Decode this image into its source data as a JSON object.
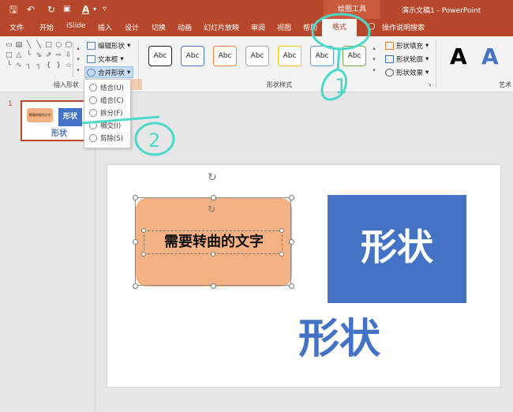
{
  "window": {
    "title": "演示文稿1 - PowerPoint",
    "context_group": "绘图工具"
  },
  "quick_access": {
    "save_icon": "save-icon",
    "undo_icon": "undo-icon",
    "redo_icon": "redo-icon",
    "font_color_label": "A",
    "customize_icon": "customize-icon"
  },
  "tabs": [
    {
      "label": "文件"
    },
    {
      "label": "开始"
    },
    {
      "label": "iSlide"
    },
    {
      "label": "插入"
    },
    {
      "label": "设计"
    },
    {
      "label": "切换"
    },
    {
      "label": "动画"
    },
    {
      "label": "幻灯片放映"
    },
    {
      "label": "审阅"
    },
    {
      "label": "视图"
    },
    {
      "label": "帮助"
    },
    {
      "label": "格式"
    },
    {
      "label": "操作说明搜索"
    }
  ],
  "ribbon": {
    "insert_shapes": {
      "group_label": "插入形状",
      "edit_shape": "编辑形状",
      "text_box": "文本框",
      "merge_shapes": "合并形状"
    },
    "shape_styles": {
      "group_label": "形状样式",
      "style_sample": "Abc",
      "styles": [
        {
          "label": "Abc",
          "border": "#222222"
        },
        {
          "label": "Abc",
          "border": "#4472c4"
        },
        {
          "label": "Abc",
          "border": "#ed7d31"
        },
        {
          "label": "Abc",
          "border": "#a5a5a5"
        },
        {
          "label": "Abc",
          "border": "#ffc000"
        },
        {
          "label": "Abc",
          "border": "#5b9bd5"
        },
        {
          "label": "Abc",
          "border": "#70ad47"
        }
      ],
      "fill": "形状填充",
      "outline": "形状轮廓",
      "effects": "形状效果"
    },
    "wordart": {
      "group_label": "艺术",
      "samples": [
        {
          "letter": "A",
          "color": "#000000"
        },
        {
          "letter": "A",
          "color": "#4472c4"
        }
      ]
    }
  },
  "merge_menu": {
    "items": [
      {
        "label": "结合(U)"
      },
      {
        "label": "组合(C)"
      },
      {
        "label": "拆分(F)"
      },
      {
        "label": "相交(I)"
      },
      {
        "label": "剪除(S)"
      }
    ]
  },
  "thumbnails": {
    "slide_number": "1",
    "small_text": "需要转曲的文字",
    "blue_text": "形状",
    "bottom_text": "形状"
  },
  "slide": {
    "orange_shape_text": "需要转曲的文字",
    "blue_box_text": "形状",
    "large_blue_text": "形状"
  },
  "colors": {
    "accent": "#b7472a",
    "orange_shape": "#f4b183",
    "blue": "#4472c4",
    "annotation": "#4dd9c9"
  },
  "annotations": {
    "label_1": "1",
    "label_2": "2"
  }
}
